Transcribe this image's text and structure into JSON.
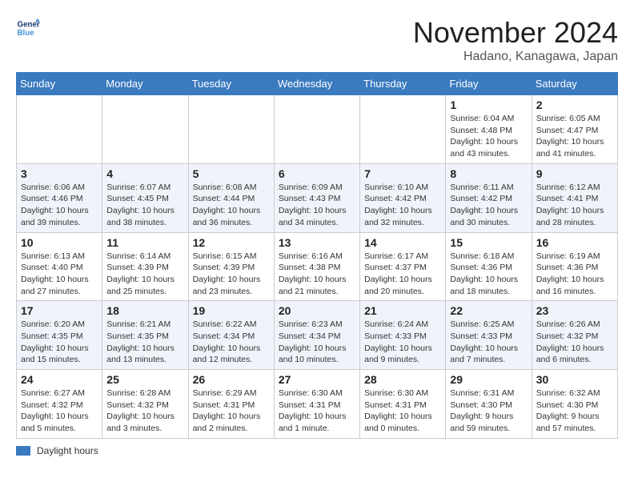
{
  "logo": {
    "line1": "General",
    "line2": "Blue",
    "icon_color": "#4a90d9"
  },
  "header": {
    "month": "November 2024",
    "location": "Hadano, Kanagawa, Japan"
  },
  "days_of_week": [
    "Sunday",
    "Monday",
    "Tuesday",
    "Wednesday",
    "Thursday",
    "Friday",
    "Saturday"
  ],
  "footer": {
    "label": "Daylight hours"
  },
  "weeks": [
    {
      "days": [
        {
          "num": "",
          "info": ""
        },
        {
          "num": "",
          "info": ""
        },
        {
          "num": "",
          "info": ""
        },
        {
          "num": "",
          "info": ""
        },
        {
          "num": "",
          "info": ""
        },
        {
          "num": "1",
          "info": "Sunrise: 6:04 AM\nSunset: 4:48 PM\nDaylight: 10 hours\nand 43 minutes."
        },
        {
          "num": "2",
          "info": "Sunrise: 6:05 AM\nSunset: 4:47 PM\nDaylight: 10 hours\nand 41 minutes."
        }
      ]
    },
    {
      "days": [
        {
          "num": "3",
          "info": "Sunrise: 6:06 AM\nSunset: 4:46 PM\nDaylight: 10 hours\nand 39 minutes."
        },
        {
          "num": "4",
          "info": "Sunrise: 6:07 AM\nSunset: 4:45 PM\nDaylight: 10 hours\nand 38 minutes."
        },
        {
          "num": "5",
          "info": "Sunrise: 6:08 AM\nSunset: 4:44 PM\nDaylight: 10 hours\nand 36 minutes."
        },
        {
          "num": "6",
          "info": "Sunrise: 6:09 AM\nSunset: 4:43 PM\nDaylight: 10 hours\nand 34 minutes."
        },
        {
          "num": "7",
          "info": "Sunrise: 6:10 AM\nSunset: 4:42 PM\nDaylight: 10 hours\nand 32 minutes."
        },
        {
          "num": "8",
          "info": "Sunrise: 6:11 AM\nSunset: 4:42 PM\nDaylight: 10 hours\nand 30 minutes."
        },
        {
          "num": "9",
          "info": "Sunrise: 6:12 AM\nSunset: 4:41 PM\nDaylight: 10 hours\nand 28 minutes."
        }
      ]
    },
    {
      "days": [
        {
          "num": "10",
          "info": "Sunrise: 6:13 AM\nSunset: 4:40 PM\nDaylight: 10 hours\nand 27 minutes."
        },
        {
          "num": "11",
          "info": "Sunrise: 6:14 AM\nSunset: 4:39 PM\nDaylight: 10 hours\nand 25 minutes."
        },
        {
          "num": "12",
          "info": "Sunrise: 6:15 AM\nSunset: 4:39 PM\nDaylight: 10 hours\nand 23 minutes."
        },
        {
          "num": "13",
          "info": "Sunrise: 6:16 AM\nSunset: 4:38 PM\nDaylight: 10 hours\nand 21 minutes."
        },
        {
          "num": "14",
          "info": "Sunrise: 6:17 AM\nSunset: 4:37 PM\nDaylight: 10 hours\nand 20 minutes."
        },
        {
          "num": "15",
          "info": "Sunrise: 6:18 AM\nSunset: 4:36 PM\nDaylight: 10 hours\nand 18 minutes."
        },
        {
          "num": "16",
          "info": "Sunrise: 6:19 AM\nSunset: 4:36 PM\nDaylight: 10 hours\nand 16 minutes."
        }
      ]
    },
    {
      "days": [
        {
          "num": "17",
          "info": "Sunrise: 6:20 AM\nSunset: 4:35 PM\nDaylight: 10 hours\nand 15 minutes."
        },
        {
          "num": "18",
          "info": "Sunrise: 6:21 AM\nSunset: 4:35 PM\nDaylight: 10 hours\nand 13 minutes."
        },
        {
          "num": "19",
          "info": "Sunrise: 6:22 AM\nSunset: 4:34 PM\nDaylight: 10 hours\nand 12 minutes."
        },
        {
          "num": "20",
          "info": "Sunrise: 6:23 AM\nSunset: 4:34 PM\nDaylight: 10 hours\nand 10 minutes."
        },
        {
          "num": "21",
          "info": "Sunrise: 6:24 AM\nSunset: 4:33 PM\nDaylight: 10 hours\nand 9 minutes."
        },
        {
          "num": "22",
          "info": "Sunrise: 6:25 AM\nSunset: 4:33 PM\nDaylight: 10 hours\nand 7 minutes."
        },
        {
          "num": "23",
          "info": "Sunrise: 6:26 AM\nSunset: 4:32 PM\nDaylight: 10 hours\nand 6 minutes."
        }
      ]
    },
    {
      "days": [
        {
          "num": "24",
          "info": "Sunrise: 6:27 AM\nSunset: 4:32 PM\nDaylight: 10 hours\nand 5 minutes."
        },
        {
          "num": "25",
          "info": "Sunrise: 6:28 AM\nSunset: 4:32 PM\nDaylight: 10 hours\nand 3 minutes."
        },
        {
          "num": "26",
          "info": "Sunrise: 6:29 AM\nSunset: 4:31 PM\nDaylight: 10 hours\nand 2 minutes."
        },
        {
          "num": "27",
          "info": "Sunrise: 6:30 AM\nSunset: 4:31 PM\nDaylight: 10 hours\nand 1 minute."
        },
        {
          "num": "28",
          "info": "Sunrise: 6:30 AM\nSunset: 4:31 PM\nDaylight: 10 hours\nand 0 minutes."
        },
        {
          "num": "29",
          "info": "Sunrise: 6:31 AM\nSunset: 4:30 PM\nDaylight: 9 hours\nand 59 minutes."
        },
        {
          "num": "30",
          "info": "Sunrise: 6:32 AM\nSunset: 4:30 PM\nDaylight: 9 hours\nand 57 minutes."
        }
      ]
    }
  ]
}
